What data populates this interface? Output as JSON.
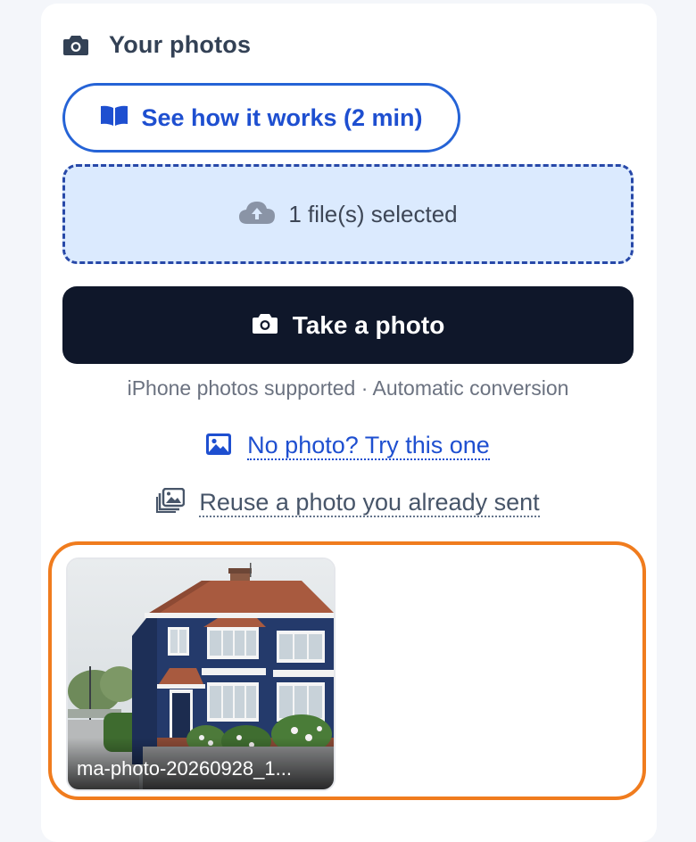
{
  "panel": {
    "title": "Your photos",
    "icon": "camera-icon"
  },
  "howto_button": {
    "label": "See how it works (2 min)",
    "icon": "book-open-icon",
    "color": "#2563d6"
  },
  "dropzone": {
    "label": "1 file(s) selected",
    "icon": "cloud-upload-icon"
  },
  "take_photo_button": {
    "label": "Take a photo",
    "icon": "camera-icon"
  },
  "hint": "iPhone photos supported · Automatic conversion",
  "sample_link": {
    "label": "No photo? Try this one",
    "icon": "image-icon"
  },
  "reuse_link": {
    "label": "Reuse a photo you already sent",
    "icon": "photo-library-icon"
  },
  "preview": {
    "highlight_color": "#f07c1e",
    "files": [
      {
        "name": "ma-photo-20260928_1..."
      }
    ]
  }
}
